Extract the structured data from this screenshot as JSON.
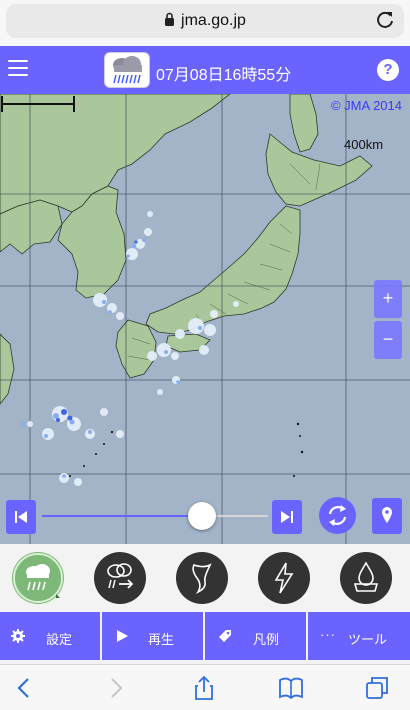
{
  "browser": {
    "host": "jma.go.jp"
  },
  "header": {
    "title": "07月08日16時55分"
  },
  "map": {
    "copyright": "© JMA 2014",
    "scale_label": "400km",
    "zoom_in_label": "+",
    "zoom_out_label": "−"
  },
  "slider": {
    "position_fraction": 0.72
  },
  "layers": [
    {
      "name": "rain-radar",
      "active": true
    },
    {
      "name": "rain-forecast",
      "active": false
    },
    {
      "name": "tornado",
      "active": false
    },
    {
      "name": "thunder",
      "active": false
    },
    {
      "name": "precip-intensity",
      "active": false
    }
  ],
  "toolbar": {
    "settings": "設定",
    "play": "再生",
    "legend": "凡例",
    "tools": "ツール",
    "tools_prefix": "···"
  },
  "colors": {
    "accent": "#6a63ff",
    "sea": "#a3b4c8",
    "land": "#a9c79a",
    "rain_light": "#d9e8fa",
    "rain_medium": "#4a7ff0"
  }
}
